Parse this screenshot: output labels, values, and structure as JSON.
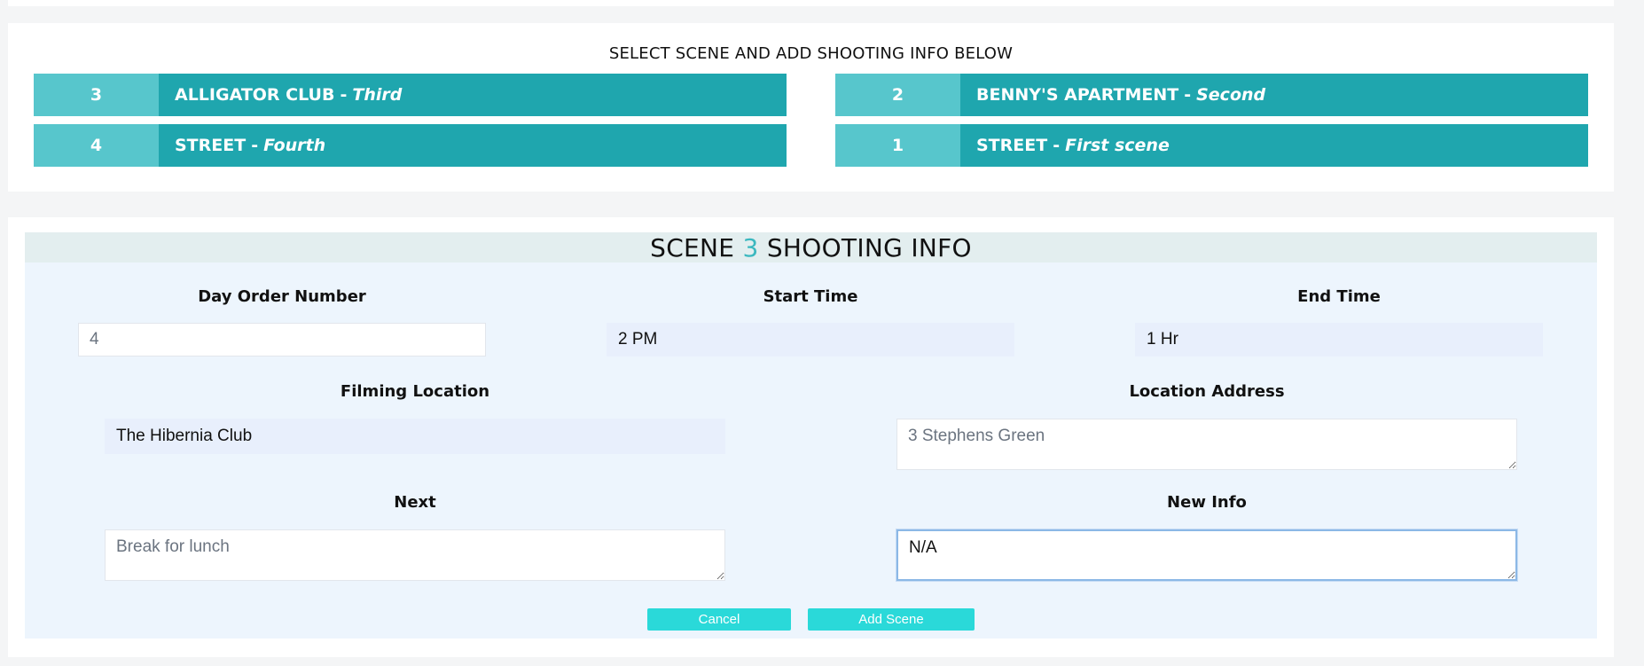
{
  "scene_select": {
    "heading": "SELECT SCENE AND ADD SHOOTING INFO BELOW",
    "scenes": [
      {
        "number": "3",
        "name": "ALLIGATOR CLUB",
        "subtitle": "Third"
      },
      {
        "number": "2",
        "name": "BENNY'S APARTMENT",
        "subtitle": "Second"
      },
      {
        "number": "4",
        "name": "STREET",
        "subtitle": "Fourth"
      },
      {
        "number": "1",
        "name": "STREET",
        "subtitle": "First scene"
      }
    ]
  },
  "shooting_info": {
    "title_prefix": "SCENE",
    "scene_number": "3",
    "title_suffix": "SHOOTING INFO",
    "accent_color": "#3bb8bf",
    "fields": {
      "day_order": {
        "label": "Day Order Number",
        "value": "",
        "placeholder": "4"
      },
      "start_time": {
        "label": "Start Time",
        "value": "2 PM"
      },
      "end_time": {
        "label": "End Time",
        "value": "1 Hr"
      },
      "filming_location": {
        "label": "Filming Location",
        "value": "The Hibernia Club"
      },
      "location_address": {
        "label": "Location Address",
        "value": "",
        "placeholder": "3 Stephens Green"
      },
      "next": {
        "label": "Next",
        "value": "",
        "placeholder": "Break for lunch"
      },
      "new_info": {
        "label": "New Info",
        "value": "N/A"
      }
    },
    "buttons": {
      "cancel": "Cancel",
      "add_scene": "Add Scene"
    }
  },
  "colors": {
    "scene_number_bg": "#57c6cc",
    "scene_name_bg": "#1fa6ae",
    "button_bg": "#2ad9d9"
  }
}
